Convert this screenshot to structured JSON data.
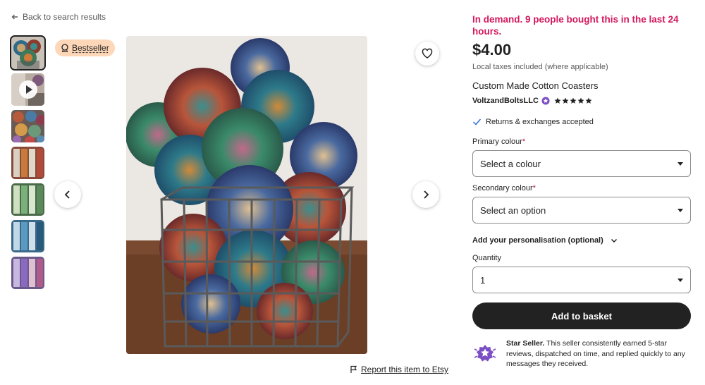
{
  "back_link": {
    "label": "Back to search results"
  },
  "badge": {
    "label": "Bestseller"
  },
  "gallery": {
    "thumbnails": [
      {
        "kind": "photo",
        "active": true
      },
      {
        "kind": "video"
      },
      {
        "kind": "photo"
      },
      {
        "kind": "photo"
      },
      {
        "kind": "photo"
      },
      {
        "kind": "photo"
      },
      {
        "kind": "photo"
      }
    ]
  },
  "report": {
    "label": "Report this item to Etsy"
  },
  "product": {
    "demand": "In demand. 9 people bought this in the last 24 hours.",
    "price": "$4.00",
    "taxes": "Local taxes included (where applicable)",
    "title": "Custom Made Cotton Coasters",
    "seller": "VoltzandBoltsLLC",
    "rating": 5,
    "returns": "Returns & exchanges accepted"
  },
  "form": {
    "primary_label": "Primary colour",
    "primary_value": "Select a colour",
    "secondary_label": "Secondary colour",
    "secondary_value": "Select an option",
    "required_mark": "*",
    "personalisation": "Add your personalisation (optional)",
    "quantity_label": "Quantity",
    "quantity_value": "1",
    "add_button": "Add to basket"
  },
  "star_seller": {
    "title": "Star Seller.",
    "text": "This seller consistently earned 5-star reviews, dispatched on time, and replied quickly to any messages they received."
  },
  "colors": {
    "demand": "#d4185d",
    "button": "#222222",
    "badge_bg": "#fdd7b8",
    "star_seller": "#7b4fc4"
  }
}
